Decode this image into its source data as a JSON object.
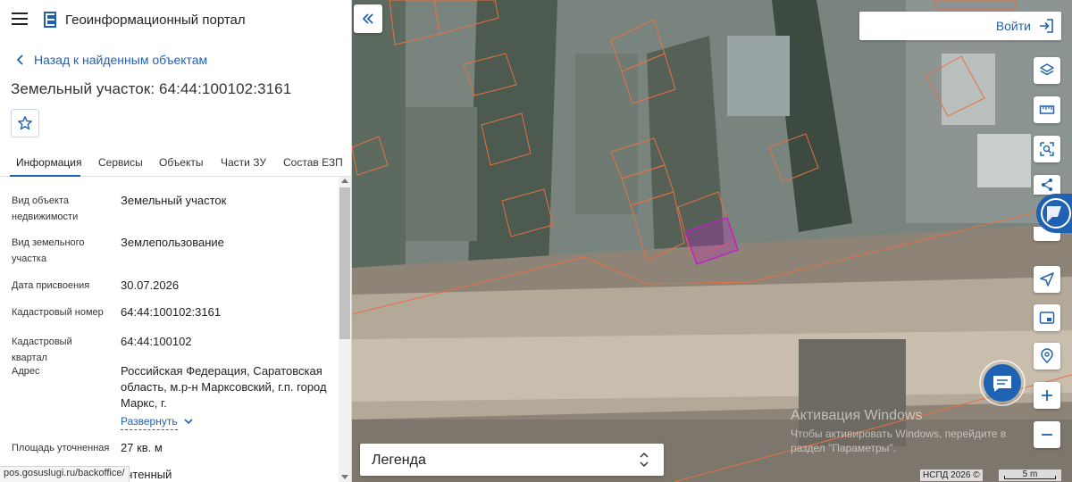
{
  "header": {
    "title": "Геоинформационный портал"
  },
  "nav": {
    "back_label": "Назад к найденным объектам"
  },
  "object": {
    "title": "Земельный участок: 64:44:100102:3161"
  },
  "tabs": [
    {
      "label": "Информация",
      "active": true
    },
    {
      "label": "Сервисы"
    },
    {
      "label": "Объекты"
    },
    {
      "label": "Части ЗУ"
    },
    {
      "label": "Состав ЕЗП"
    }
  ],
  "info_rows": [
    {
      "label": "Вид объекта недвижимости",
      "value": "Земельный участок"
    },
    {
      "label": "Вид земельного участка",
      "value": "Землепользование"
    },
    {
      "label": "Дата присвоения",
      "value": "30.07.2026"
    },
    {
      "label": "Кадастровый номер",
      "value": "64:44:100102:3161"
    },
    {
      "label": "Кадастровый квартал",
      "value": "64:44:100102"
    },
    {
      "label": "Адрес",
      "value": "Российская Федерация, Саратовская область, м.р-н Марксовский, г.п. город Маркс, г.",
      "expand_label": "Развернуть"
    },
    {
      "label": "Площадь уточненная",
      "value": "27 кв. м"
    }
  ],
  "status_bar": {
    "url": "pos.gosuslugi.ru/backoffice/",
    "overlap_text": "/чтенный"
  },
  "map": {
    "login_label": "Войти",
    "legend_label": "Легенда",
    "copyright": "НСПД 2026 ©",
    "scale_label": "5 m",
    "watermark": {
      "title": "Активация Windows",
      "line1": "Чтобы активировать Windows, перейдите в",
      "line2": "раздел \"Параметры\"."
    },
    "tool_icons": [
      "layers-icon",
      "ruler-icon",
      "select-area-icon",
      "share-icon",
      "navigation-icon",
      "picture-in-picture-icon",
      "location-icon",
      "zoom-in-icon",
      "zoom-out-icon"
    ]
  },
  "colors": {
    "accent": "#1f62b3",
    "parcel_outline": "#e8703f",
    "selected_parcel": "#c21fc5"
  }
}
